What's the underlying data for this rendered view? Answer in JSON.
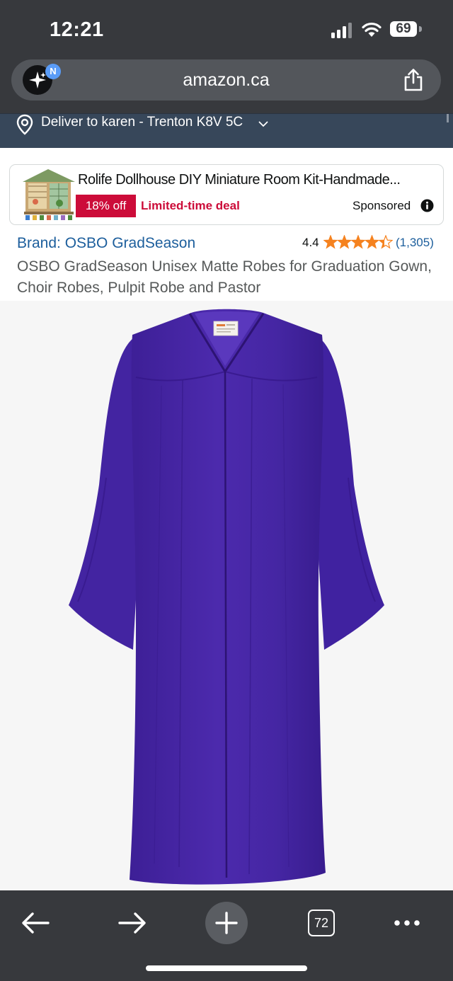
{
  "status_bar": {
    "time": "12:21",
    "battery": "69",
    "icons": [
      "signal-icon",
      "wifi-icon",
      "battery-icon"
    ]
  },
  "browser": {
    "url": "amazon.ca",
    "badge_letter": "N",
    "icons": [
      "ai-assistant-icon",
      "share-icon"
    ]
  },
  "delivery": {
    "text": "Deliver to karen - Trenton K8V 5C"
  },
  "sponsored_ad": {
    "title": "Rolife Dollhouse DIY Miniature Room Kit-Handmade...",
    "discount": "18% off",
    "deal_label": "Limited-time deal",
    "sponsored_label": "Sponsored"
  },
  "product": {
    "brand": "Brand: OSBO GradSeason",
    "rating": "4.4",
    "rating_stars": 4.4,
    "review_count": "(1,305)",
    "title": "OSBO GradSeason Unisex Matte Robes for Graduation Gown, Choir Robes, Pulpit Robe and Pastor",
    "robe_color": "#4a27a7"
  },
  "toolbar": {
    "tab_count": "72",
    "icons": [
      "back-arrow-icon",
      "forward-arrow-icon",
      "plus-icon",
      "tabs-icon",
      "more-icon"
    ]
  },
  "colors": {
    "chrome": "#37393d",
    "deliver_bar": "#37475a",
    "deal_red": "#cc0c39",
    "link_blue": "#1c5e9c",
    "star_orange": "#f5821f"
  }
}
